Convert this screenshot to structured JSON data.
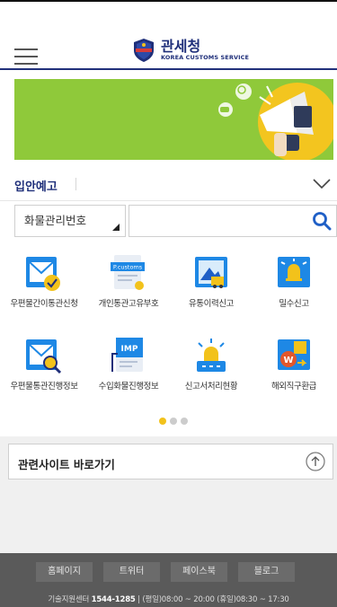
{
  "header": {
    "logo_ko": "관세청",
    "logo_en": "KOREA CUSTOMS SERVICE"
  },
  "notice": {
    "label": "입안예고"
  },
  "search": {
    "type_label": "화물관리번호",
    "input_value": "",
    "placeholder": ""
  },
  "menu": {
    "items": [
      {
        "label": "우편물간이통관신청",
        "icon": "postal-check-icon"
      },
      {
        "label": "개인통관고유부호",
        "icon": "p-customs-icon"
      },
      {
        "label": "유통이력신고",
        "icon": "delivery-truck-icon"
      },
      {
        "label": "밀수신고",
        "icon": "alert-bell-icon"
      },
      {
        "label": "우편물통관진행정보",
        "icon": "postal-search-icon"
      },
      {
        "label": "수입화물진행정보",
        "icon": "imp-document-icon"
      },
      {
        "label": "신고서처리현황",
        "icon": "siren-icon"
      },
      {
        "label": "해외직구환급",
        "icon": "won-refund-icon"
      }
    ]
  },
  "pagination": {
    "count": 3,
    "active_index": 0
  },
  "related": {
    "label": "관련사이트 바로가기"
  },
  "footer": {
    "links": [
      "홈페이지",
      "트위터",
      "페이스북",
      "블로그"
    ],
    "center_label": "기술지원센터",
    "phone": "1544-1285",
    "hours": "| (평일)08:00 ~ 20:00 (휴일)08:30 ~ 17:30"
  },
  "colors": {
    "brand_navy": "#1f2f7a",
    "banner_green": "#8fc93a",
    "icon_blue": "#1e88e5",
    "accent_yellow": "#f2c21b"
  }
}
